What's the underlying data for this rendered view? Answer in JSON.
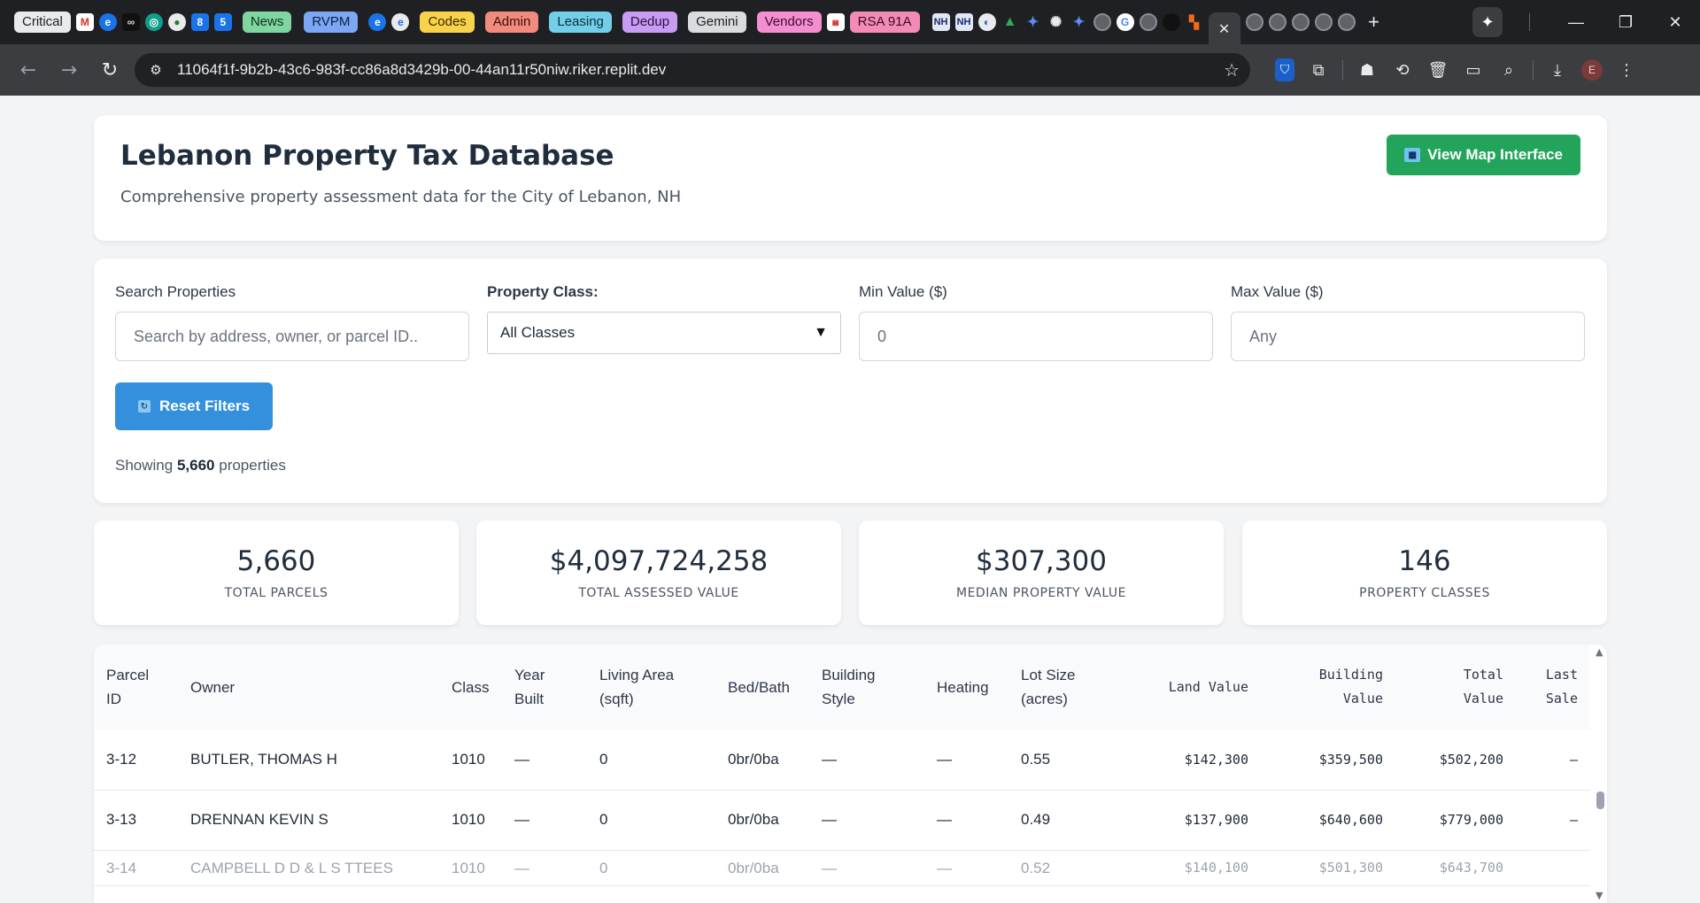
{
  "browser": {
    "bookmarks": [
      {
        "label": "Critical",
        "bg": "#e8eaed",
        "fg": "#202124"
      },
      {
        "label": "News",
        "bg": "#7fd6a0",
        "fg": "#103020"
      },
      {
        "label": "RVPM",
        "bg": "#7ba7f5",
        "fg": "#102040"
      },
      {
        "label": "Codes",
        "bg": "#f7d24a",
        "fg": "#3a2a00"
      },
      {
        "label": "Admin",
        "bg": "#f28b7d",
        "fg": "#3a0d08"
      },
      {
        "label": "Leasing",
        "bg": "#73cfe8",
        "fg": "#0b2f3a"
      },
      {
        "label": "Dedup",
        "bg": "#c79cf2",
        "fg": "#2a0f45"
      },
      {
        "label": "Gemini",
        "bg": "#dadce0",
        "fg": "#202124"
      },
      {
        "label": "Vendors",
        "bg": "#f38fd0",
        "fg": "#3e0b2c"
      },
      {
        "label": "RSA 91A",
        "bg": "#f28bb6",
        "fg": "#3e0b22"
      }
    ],
    "favicons": {
      "nh1": "NH",
      "nh2": "NH",
      "num8": "8",
      "num5": "5"
    },
    "url": "11064f1f-9b2b-43c6-983f-cc86a8d3429b-00-44an11r50niw.riker.replit.dev",
    "avatar_letter": "E"
  },
  "header": {
    "title": "Lebanon Property Tax Database",
    "subtitle": "Comprehensive property assessment data for the City of Lebanon, NH",
    "map_button": "View Map Interface"
  },
  "filters": {
    "search_label": "Search Properties",
    "search_placeholder": "Search by address, owner, or parcel ID..",
    "class_label": "Property Class:",
    "class_value": "All Classes",
    "min_label": "Min Value ($)",
    "min_value": "0",
    "max_label": "Max Value ($)",
    "max_placeholder": "Any",
    "reset_button": "Reset Filters",
    "showing_prefix": "Showing",
    "showing_count": "5,660",
    "showing_suffix": "properties"
  },
  "stats": [
    {
      "value": "5,660",
      "label": "TOTAL PARCELS"
    },
    {
      "value": "$4,097,724,258",
      "label": "TOTAL ASSESSED VALUE"
    },
    {
      "value": "$307,300",
      "label": "MEDIAN PROPERTY VALUE"
    },
    {
      "value": "146",
      "label": "PROPERTY CLASSES"
    }
  ],
  "table": {
    "headers": [
      {
        "line1": "Parcel",
        "line2": "ID"
      },
      {
        "line1": "Owner",
        "line2": ""
      },
      {
        "line1": "Class",
        "line2": ""
      },
      {
        "line1": "Year",
        "line2": "Built"
      },
      {
        "line1": "Living Area",
        "line2": "(sqft)"
      },
      {
        "line1": "Bed/Bath",
        "line2": ""
      },
      {
        "line1": "Building",
        "line2": "Style"
      },
      {
        "line1": "Heating",
        "line2": ""
      },
      {
        "line1": "Lot Size",
        "line2": "(acres)"
      },
      {
        "line1": "Land Value",
        "line2": ""
      },
      {
        "line1": "Building",
        "line2": "Value"
      },
      {
        "line1": "Total",
        "line2": "Value"
      },
      {
        "line1": "Last",
        "line2": "Sale"
      }
    ],
    "rows": [
      [
        "3-12",
        "BUTLER, THOMAS H",
        "1010",
        "—",
        "0",
        "0br/0ba",
        "—",
        "—",
        "0.55",
        "$142,300",
        "$359,500",
        "$502,200",
        "–"
      ],
      [
        "3-13",
        "DRENNAN KEVIN S",
        "1010",
        "—",
        "0",
        "0br/0ba",
        "—",
        "—",
        "0.49",
        "$137,900",
        "$640,600",
        "$779,000",
        "–"
      ]
    ],
    "partial_row": [
      "3-14",
      "CAMPBELL D D & L S TTEES",
      "1010",
      "—",
      "0",
      "0br/0ba",
      "—",
      "—",
      "0.52",
      "$140,100",
      "$501,300",
      "$643,700",
      ""
    ]
  }
}
